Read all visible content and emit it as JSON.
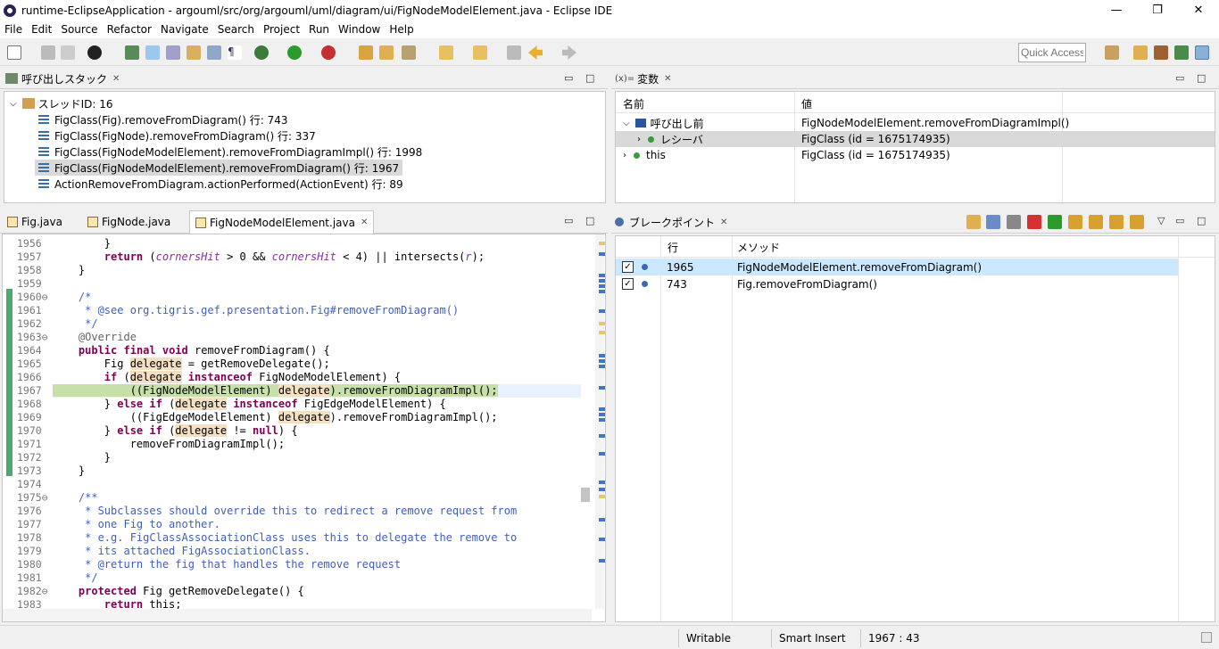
{
  "window": {
    "title": "runtime-EclipseApplication - argouml/src/org/argouml/uml/diagram/ui/FigNodeModelElement.java - Eclipse IDE",
    "min": "—",
    "max": "❐",
    "close": "✕"
  },
  "menu": [
    "File",
    "Edit",
    "Source",
    "Refactor",
    "Navigate",
    "Search",
    "Project",
    "Run",
    "Window",
    "Help"
  ],
  "quick_access": {
    "placeholder": "Quick Access"
  },
  "callstack": {
    "title": "呼び出しスタック",
    "thread": "スレッドID: 16",
    "frames": [
      "FigClass(Fig).removeFromDiagram() 行: 743",
      "FigClass(FigNode).removeFromDiagram() 行: 337",
      "FigClass(FigNodeModelElement).removeFromDiagramImpl() 行: 1998",
      "FigClass(FigNodeModelElement).removeFromDiagram() 行: 1967",
      "ActionRemoveFromDiagram.actionPerformed(ActionEvent) 行: 89"
    ]
  },
  "variables": {
    "title": "変数",
    "prefix": "(x)=",
    "col_name": "名前",
    "col_value": "値",
    "rows": [
      {
        "name": "呼び出し前",
        "value": "FigNodeModelElement.removeFromDiagramImpl()"
      },
      {
        "name": "レシーバ",
        "value": "FigClass (id = 1675174935)"
      },
      {
        "name": "this",
        "value": "FigClass (id = 1675174935)"
      }
    ]
  },
  "editor": {
    "tabs": [
      "Fig.java",
      "FigNode.java",
      "FigNodeModelElement.java"
    ],
    "active_tab": 2,
    "lines": [
      {
        "n": "1956",
        "t": "        }"
      },
      {
        "n": "1957",
        "t": "        return (cornersHit > 0 && cornersHit < 4) || intersects(r);"
      },
      {
        "n": "1958",
        "t": "    }"
      },
      {
        "n": "1959",
        "t": ""
      },
      {
        "n": "1960⊖",
        "t": "    /*"
      },
      {
        "n": "1961",
        "t": "     * @see org.tigris.gef.presentation.Fig#removeFromDiagram()"
      },
      {
        "n": "1962",
        "t": "     */"
      },
      {
        "n": "1963⊖",
        "t": "    @Override"
      },
      {
        "n": "1964",
        "t": "    public final void removeFromDiagram() {"
      },
      {
        "n": "1965",
        "t": "        Fig delegate = getRemoveDelegate();"
      },
      {
        "n": "1966",
        "t": "        if (delegate instanceof FigNodeModelElement) {"
      },
      {
        "n": "1967",
        "t": "            ((FigNodeModelElement) delegate).removeFromDiagramImpl();"
      },
      {
        "n": "1968",
        "t": "        } else if (delegate instanceof FigEdgeModelElement) {"
      },
      {
        "n": "1969",
        "t": "            ((FigEdgeModelElement) delegate).removeFromDiagramImpl();"
      },
      {
        "n": "1970",
        "t": "        } else if (delegate != null) {"
      },
      {
        "n": "1971",
        "t": "            removeFromDiagramImpl();"
      },
      {
        "n": "1972",
        "t": "        }"
      },
      {
        "n": "1973",
        "t": "    }"
      },
      {
        "n": "1974",
        "t": ""
      },
      {
        "n": "1975⊖",
        "t": "    /**"
      },
      {
        "n": "1976",
        "t": "     * Subclasses should override this to redirect a remove request from"
      },
      {
        "n": "1977",
        "t": "     * one Fig to another."
      },
      {
        "n": "1978",
        "t": "     * e.g. FigClassAssociationClass uses this to delegate the remove to"
      },
      {
        "n": "1979",
        "t": "     * its attached FigAssociationClass."
      },
      {
        "n": "1980",
        "t": "     * @return the fig that handles the remove request"
      },
      {
        "n": "1981",
        "t": "     */"
      },
      {
        "n": "1982⊖",
        "t": "    protected Fig getRemoveDelegate() {"
      },
      {
        "n": "1983",
        "t": "        return this;"
      }
    ]
  },
  "breakpoints": {
    "title": "ブレークポイント",
    "col_line": "行",
    "col_method": "メソッド",
    "rows": [
      {
        "line": "1965",
        "method": "FigNodeModelElement.removeFromDiagram()"
      },
      {
        "line": "743",
        "method": "Fig.removeFromDiagram()"
      }
    ]
  },
  "status": {
    "writable": "Writable",
    "insert": "Smart Insert",
    "position": "1967 : 43"
  }
}
